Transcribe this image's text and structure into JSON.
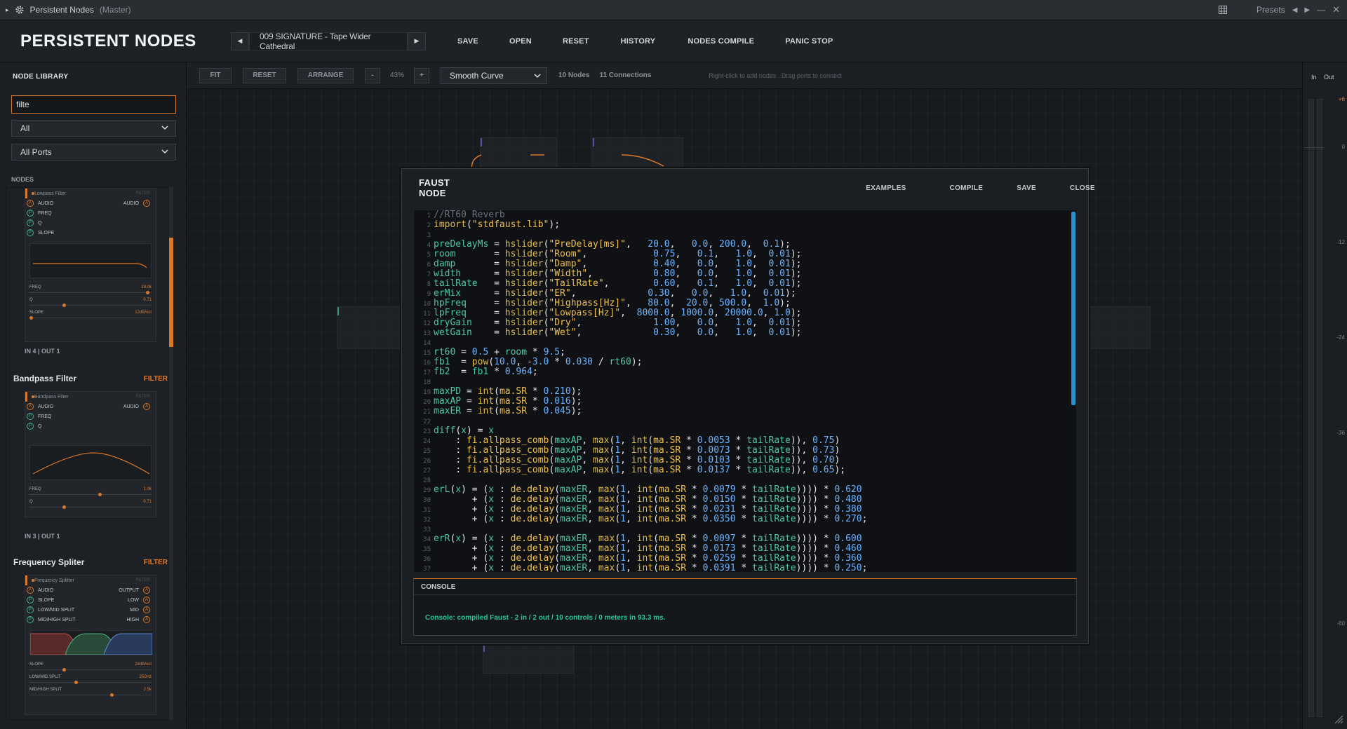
{
  "window": {
    "title": "Persistent Nodes",
    "subtitle": "(Master)",
    "presets_label": "Presets"
  },
  "header": {
    "app_title": "PERSISTENT NODES",
    "preset_name": "009 SIGNATURE - Tape Wider Cathedral",
    "buttons": [
      "SAVE",
      "OPEN",
      "RESET",
      "HISTORY",
      "NODES COMPILE",
      "PANIC STOP"
    ]
  },
  "sidebar": {
    "title": "NODE LIBRARY",
    "search_value": "filte",
    "category_select": "All",
    "ports_select": "All Ports",
    "nodes_label": "NODES",
    "cards": [
      {
        "name": "Lowpass Filter",
        "category": "FILTER",
        "preview_title": "Lowpass Filter",
        "ports": [
          {
            "label": "AUDIO",
            "kind": "A",
            "right": "AUDIO"
          },
          {
            "label": "FREQ",
            "kind": "P"
          },
          {
            "label": "Q",
            "kind": "P"
          },
          {
            "label": "SLOPE",
            "kind": "P"
          }
        ],
        "sliders": [
          {
            "label": "FREQ",
            "value": "18.0k",
            "level": 0.98
          },
          {
            "label": "Q",
            "value": "0.71",
            "level": 0.28
          },
          {
            "label": "SLOPE",
            "value": "12dB/oct",
            "level": 0.0
          }
        ],
        "io": "IN 4  |  OUT 1"
      },
      {
        "name": "Bandpass Filter",
        "category": "FILTER",
        "preview_title": "Bandpass Filter",
        "ports": [
          {
            "label": "AUDIO",
            "kind": "A",
            "right": "AUDIO"
          },
          {
            "label": "FREQ",
            "kind": "P"
          },
          {
            "label": "Q",
            "kind": "P"
          }
        ],
        "sliders": [
          {
            "label": "FREQ",
            "value": "1.0k",
            "level": 0.58
          },
          {
            "label": "Q",
            "value": "0.71",
            "level": 0.28
          }
        ],
        "io": "IN 3  |  OUT 1"
      },
      {
        "name": "Frequency Spliter",
        "category": "FILTER",
        "preview_title": "Frequency Splitter",
        "ports": [
          {
            "label": "AUDIO",
            "kind": "A",
            "right": "OUTPUT"
          },
          {
            "label": "SLOPE",
            "kind": "P",
            "right": "LOW"
          },
          {
            "label": "LOW/MID SPLIT",
            "kind": "P",
            "right": "MID"
          },
          {
            "label": "MID/HIGH SPLIT",
            "kind": "P",
            "right": "HIGH"
          }
        ],
        "sliders": [
          {
            "label": "SLOPE",
            "value": "24dB/oct",
            "level": 0.28
          },
          {
            "label": "LOW/MID SPLIT",
            "value": "250Hz",
            "level": 0.38
          },
          {
            "label": "MID/HIGH SPLIT",
            "value": "2.5k",
            "level": 0.68
          }
        ]
      }
    ]
  },
  "canvas": {
    "toolbar": {
      "fit": "FIT",
      "reset": "RESET",
      "arrange": "ARRANGE",
      "zoom_out": "-",
      "zoom": "43%",
      "zoom_in": "+",
      "curve": "Smooth Curve",
      "nodes_count": "10 Nodes",
      "connections_count": "11 Connections",
      "hint": "Right-click to add nodes  .  Drag ports to connect"
    }
  },
  "meter": {
    "in_label": "In",
    "out_label": "Out",
    "scale": [
      "+6",
      "0",
      "-12",
      "-24",
      "-36",
      "-60"
    ]
  },
  "faust_modal": {
    "title": "FAUST NODE",
    "buttons": [
      "EXAMPLES",
      "COMPILE",
      "SAVE",
      "CLOSE"
    ],
    "code_lines": [
      "//RT60 Reverb",
      "import(\"stdfaust.lib\");",
      "",
      "preDelayMs = hslider(\"PreDelay[ms]\",   20.0,   0.0, 200.0,  0.1);",
      "room       = hslider(\"Room\",            0.75,   0.1,   1.0,  0.01);",
      "damp       = hslider(\"Damp\",            0.40,   0.0,   1.0,  0.01);",
      "width      = hslider(\"Width\",           0.80,   0.0,   1.0,  0.01);",
      "tailRate   = hslider(\"TailRate\",        0.60,   0.1,   1.0,  0.01);",
      "erMix      = hslider(\"ER\",             0.30,   0.0,   1.0,  0.01);",
      "hpFreq     = hslider(\"Highpass[Hz]\",   80.0,  20.0, 500.0,  1.0);",
      "lpFreq     = hslider(\"Lowpass[Hz]\",  8000.0, 1000.0, 20000.0, 1.0);",
      "dryGain    = hslider(\"Dry\",             1.00,   0.0,   1.0,  0.01);",
      "wetGain    = hslider(\"Wet\",             0.30,   0.0,   1.0,  0.01);",
      "",
      "rt60 = 0.5 + room * 9.5;",
      "fb1  = pow(10.0, -3.0 * 0.030 / rt60);",
      "fb2  = fb1 * 0.964;",
      "",
      "maxPD = int(ma.SR * 0.210);",
      "maxAP = int(ma.SR * 0.016);",
      "maxER = int(ma.SR * 0.045);",
      "",
      "diff(x) = x",
      "    : fi.allpass_comb(maxAP, max(1, int(ma.SR * 0.0053 * tailRate)), 0.75)",
      "    : fi.allpass_comb(maxAP, max(1, int(ma.SR * 0.0073 * tailRate)), 0.73)",
      "    : fi.allpass_comb(maxAP, max(1, int(ma.SR * 0.0103 * tailRate)), 0.70)",
      "    : fi.allpass_comb(maxAP, max(1, int(ma.SR * 0.0137 * tailRate)), 0.65);",
      "",
      "erL(x) = (x : de.delay(maxER, max(1, int(ma.SR * 0.0079 * tailRate)))) * 0.620",
      "       + (x : de.delay(maxER, max(1, int(ma.SR * 0.0150 * tailRate)))) * 0.480",
      "       + (x : de.delay(maxER, max(1, int(ma.SR * 0.0231 * tailRate)))) * 0.380",
      "       + (x : de.delay(maxER, max(1, int(ma.SR * 0.0350 * tailRate)))) * 0.270;",
      "",
      "erR(x) = (x : de.delay(maxER, max(1, int(ma.SR * 0.0097 * tailRate)))) * 0.600",
      "       + (x : de.delay(maxER, max(1, int(ma.SR * 0.0173 * tailRate)))) * 0.460",
      "       + (x : de.delay(maxER, max(1, int(ma.SR * 0.0259 * tailRate)))) * 0.360",
      "       + (x : de.delay(maxER, max(1, int(ma.SR * 0.0391 * tailRate)))) * 0.250;"
    ],
    "console_title": "CONSOLE",
    "console_message": "Console: compiled Faust - 2 in / 2 out / 10 controls / 0 meters in 93.3 ms."
  },
  "colors": {
    "accent_orange": "#d9772a",
    "accent_green": "#2fc39a",
    "code_blue": "#6db3ff"
  }
}
